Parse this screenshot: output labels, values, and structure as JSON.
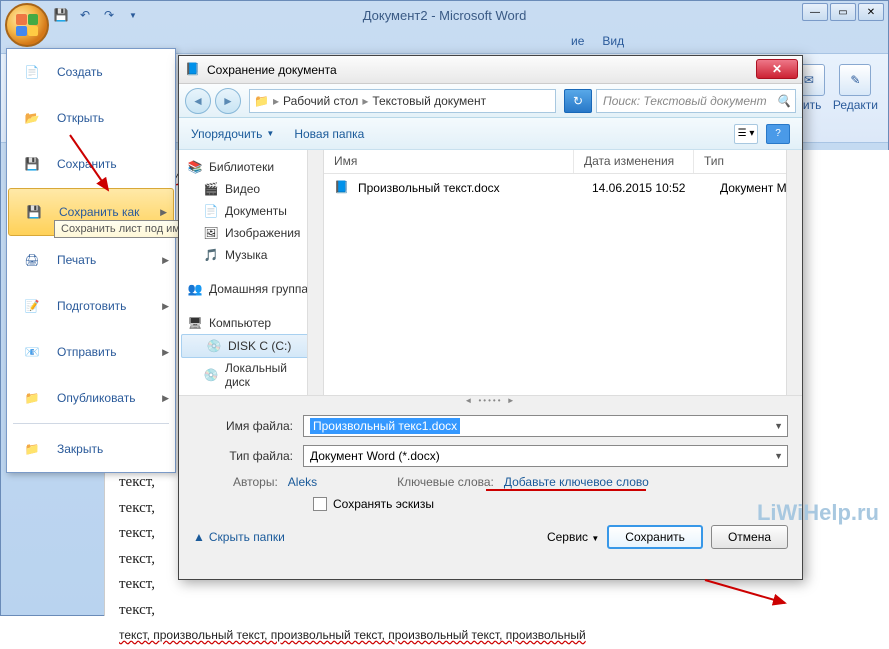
{
  "window": {
    "title": "Документ2 - Microsoft Word",
    "tabs": {
      "t1": "ие",
      "t2": "Вид"
    },
    "ribbon": {
      "edit": "Редакти",
      "send": "нить"
    }
  },
  "office_menu": {
    "create": "Создать",
    "open": "Открыть",
    "save": "Сохранить",
    "save_as": "Сохранить как",
    "print": "Печать",
    "prepare": "Подготовить",
    "send": "Отправить",
    "publish": "Опубликовать",
    "close": "Закрыть",
    "tooltip": "Сохранить лист под им"
  },
  "dialog": {
    "title": "Сохранение документа",
    "breadcrumb": {
      "seg1": "Рабочий стол",
      "seg2": "Текстовый документ"
    },
    "search_placeholder": "Поиск: Текстовый документ",
    "toolbar": {
      "organize": "Упорядочить",
      "new_folder": "Новая папка"
    },
    "tree": {
      "libraries": "Библиотеки",
      "video": "Видео",
      "documents": "Документы",
      "pictures": "Изображения",
      "music": "Музыка",
      "homegroup": "Домашняя группа",
      "computer": "Компьютер",
      "disk_c": "DISK C (C:)",
      "local_disk": "Локальный диск"
    },
    "columns": {
      "name": "Имя",
      "date": "Дата изменения",
      "type": "Тип"
    },
    "file": {
      "name": "Произвольный текст.docx",
      "date": "14.06.2015 10:52",
      "type": "Документ M"
    },
    "filename_label": "Имя файла:",
    "filename_value": "Произвольный текс1.docx",
    "filetype_label": "Тип файла:",
    "filetype_value": "Документ Word (*.docx)",
    "authors_label": "Авторы:",
    "authors_value": "Aleks",
    "keywords_label": "Ключевые слова:",
    "keywords_value": "Добавьте ключевое слово",
    "save_thumb": "Сохранять эскизы",
    "hide_folders": "Скрыть папки",
    "service": "Сервис",
    "save_btn": "Сохранить",
    "cancel_btn": "Отмена"
  },
  "doc_text": "текст, произвольный текст, произвольный текст, произвольный текст, произвольный",
  "watermark": "LiWiHelp.ru"
}
